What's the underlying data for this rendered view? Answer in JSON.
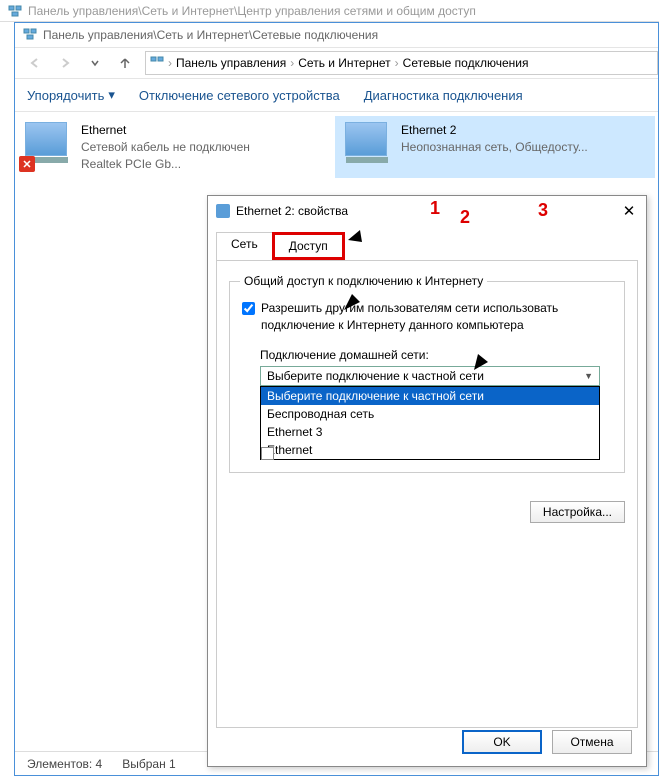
{
  "bg_title": "Панель управления\\Сеть и Интернет\\Центр управления сетями и общим доступ",
  "explorer": {
    "title": "Панель управления\\Сеть и Интернет\\Сетевые подключения",
    "breadcrumb": [
      "Панель управления",
      "Сеть и Интернет",
      "Сетевые подключения"
    ],
    "toolbar": {
      "arrange": "Упорядочить",
      "disable": "Отключение сетевого устройства",
      "diag": "Диагностика подключения"
    },
    "connections": [
      {
        "name": "Ethernet",
        "status": "Сетевой кабель не подключен",
        "device": "Realtek PCIe Gb...",
        "err": true
      },
      {
        "name": "Ethernet 2",
        "status": "Неопознанная сеть, Общедосту...",
        "device": "",
        "err": false
      }
    ],
    "status": {
      "items": "Элементов: 4",
      "selected": "Выбран 1"
    }
  },
  "dialog": {
    "title": "Ethernet 2: свойства",
    "tabs": {
      "network": "Сеть",
      "sharing": "Доступ"
    },
    "group_title": "Общий доступ к подключению к Интернету",
    "chk1_label": "Разрешить другим пользователям сети использовать подключение к Интернету данного компьютера",
    "home_label": "Подключение домашней сети:",
    "combo_value": "Выберите подключение к частной сети",
    "dropdown": [
      "Выберите подключение к частной сети",
      "Беспроводная сеть",
      "Ethernet 3",
      "Ethernet"
    ],
    "btn_settings": "Настройка...",
    "btn_ok": "OK",
    "btn_cancel": "Отмена"
  },
  "annotations": {
    "a1": "1",
    "a2": "2",
    "a3": "3"
  }
}
